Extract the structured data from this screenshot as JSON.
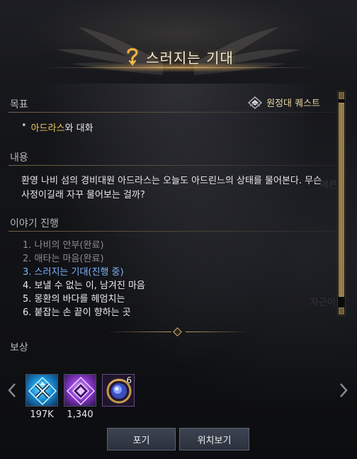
{
  "header": {
    "title": "스러지는 기대"
  },
  "goal": {
    "label": "목표",
    "quest_type": "원정대 퀘스트",
    "item_highlight": "아드라스",
    "item_rest": "와 대화"
  },
  "content": {
    "label": "내용",
    "text": "환영 나비 섬의 경비대원 아드라스는 오늘도 아드린느의 상태를 물어본다. 무슨 사정이길래 자꾸 물어보는 걸까?"
  },
  "story": {
    "label": "이야기 진행",
    "items": [
      {
        "text": "1. 나비의 안부(완료)",
        "state": "done"
      },
      {
        "text": "2. 애타는 마음(완료)",
        "state": "done"
      },
      {
        "text": "3. 스러지는 기대(진행 중)",
        "state": "current"
      },
      {
        "text": "4. 보낼 수 없는 이, 남겨진 마음",
        "state": "upcoming"
      },
      {
        "text": "5. 몽환의 바다를 헤엄치는",
        "state": "upcoming"
      },
      {
        "text": "6. 붙잡는 손 끝이 향하는 곳",
        "state": "upcoming"
      }
    ]
  },
  "reward": {
    "label": "보상",
    "items": [
      {
        "icon": "blue-crest-icon",
        "value": "197K",
        "count": ""
      },
      {
        "icon": "purple-crest-icon",
        "value": "1,340",
        "count": ""
      },
      {
        "icon": "orb-icon",
        "value": "",
        "count": "6"
      }
    ]
  },
  "buttons": {
    "abandon": "포기",
    "locate": "위치보기"
  },
  "background_hints": [
    "에른",
    "자근이"
  ],
  "colors": {
    "title": "#f2ead8",
    "highlight": "#f0c95e",
    "current_step": "#7fb4ff",
    "done_step": "#8c8c8c",
    "gold_accent": "#c9a76a"
  }
}
